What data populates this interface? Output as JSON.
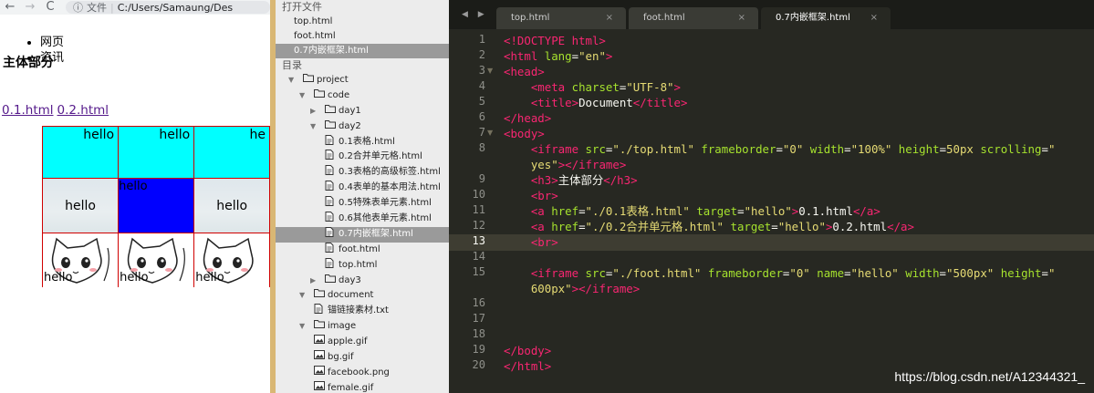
{
  "browser": {
    "back_icon": "←",
    "forward_icon": "→",
    "reload_icon": "C",
    "info_icon": "ⓘ",
    "url_label": "文件",
    "url_path": "C:/Users/Samaung/Des",
    "nav_items": [
      "网页",
      "资讯"
    ],
    "heading": "主体部分",
    "links": [
      "0.1.html",
      "0.2.html"
    ],
    "foot_table": {
      "row1": [
        "hello",
        "hello",
        "he"
      ],
      "row2": [
        "hello",
        "hello",
        "hello"
      ],
      "row3": [
        "hello",
        "hello",
        "hello"
      ]
    },
    "colors": {
      "cyan_cell": "#00ffff",
      "blue_cell": "#0000ff",
      "border": "#d00000",
      "link": "#551a8b"
    }
  },
  "sidebar": {
    "open_files_header": "打开文件",
    "open_files": [
      "top.html",
      "foot.html",
      "0.7内嵌框架.html"
    ],
    "folders_header": "目录",
    "tree": [
      {
        "label": "project",
        "type": "folder",
        "open": true,
        "depth": 0
      },
      {
        "label": "code",
        "type": "folder",
        "open": true,
        "depth": 1
      },
      {
        "label": "day1",
        "type": "folder",
        "open": false,
        "depth": 2
      },
      {
        "label": "day2",
        "type": "folder",
        "open": true,
        "depth": 2
      },
      {
        "label": "0.1表格.html",
        "type": "file",
        "depth": 3
      },
      {
        "label": "0.2合并单元格.html",
        "type": "file",
        "depth": 3
      },
      {
        "label": "0.3表格的高级标签.html",
        "type": "file",
        "depth": 3
      },
      {
        "label": "0.4表单的基本用法.html",
        "type": "file",
        "depth": 3
      },
      {
        "label": "0.5特殊表单元素.html",
        "type": "file",
        "depth": 3
      },
      {
        "label": "0.6其他表单元素.html",
        "type": "file",
        "depth": 3
      },
      {
        "label": "0.7内嵌框架.html",
        "type": "file",
        "depth": 3,
        "selected": true
      },
      {
        "label": "foot.html",
        "type": "file",
        "depth": 3
      },
      {
        "label": "top.html",
        "type": "file",
        "depth": 3
      },
      {
        "label": "day3",
        "type": "folder",
        "open": false,
        "depth": 2
      },
      {
        "label": "document",
        "type": "folder",
        "open": true,
        "depth": 1
      },
      {
        "label": "锚链接素材.txt",
        "type": "file",
        "depth": 2
      },
      {
        "label": "image",
        "type": "folder",
        "open": true,
        "depth": 1
      },
      {
        "label": "apple.gif",
        "type": "image",
        "depth": 2
      },
      {
        "label": "bg.gif",
        "type": "image",
        "depth": 2
      },
      {
        "label": "facebook.png",
        "type": "image",
        "depth": 2
      },
      {
        "label": "female.gif",
        "type": "image",
        "depth": 2
      }
    ]
  },
  "editor": {
    "tab_arrows": "◀ ▶",
    "tabs": [
      {
        "label": "top.html",
        "active": false
      },
      {
        "label": "foot.html",
        "active": false
      },
      {
        "label": "0.7内嵌框架.html",
        "active": true
      }
    ],
    "tab_close": "×",
    "current_line": 13,
    "lines": [
      {
        "n": "1",
        "segs": [
          [
            "tag",
            "<!DOCTYPE html>"
          ]
        ]
      },
      {
        "n": "2",
        "segs": [
          [
            "tag",
            "<html "
          ],
          [
            "attr",
            "lang"
          ],
          [
            "txt",
            "="
          ],
          [
            "str",
            "\"en\""
          ],
          [
            "tag",
            ">"
          ]
        ]
      },
      {
        "n": "3",
        "fold": true,
        "segs": [
          [
            "tag",
            "<head>"
          ]
        ]
      },
      {
        "n": "4",
        "segs": [
          [
            "txt",
            "    "
          ],
          [
            "tag",
            "<meta "
          ],
          [
            "attr",
            "charset"
          ],
          [
            "txt",
            "="
          ],
          [
            "str",
            "\"UTF-8\""
          ],
          [
            "tag",
            ">"
          ]
        ]
      },
      {
        "n": "5",
        "segs": [
          [
            "txt",
            "    "
          ],
          [
            "tag",
            "<title>"
          ],
          [
            "txt",
            "Document"
          ],
          [
            "tag",
            "</title>"
          ]
        ]
      },
      {
        "n": "6",
        "segs": [
          [
            "tag",
            "</head>"
          ]
        ]
      },
      {
        "n": "7",
        "fold": true,
        "segs": [
          [
            "tag",
            "<body>"
          ]
        ]
      },
      {
        "n": "8",
        "segs": [
          [
            "txt",
            "    "
          ],
          [
            "tag",
            "<iframe "
          ],
          [
            "attr",
            "src"
          ],
          [
            "txt",
            "="
          ],
          [
            "str",
            "\"./top.html\""
          ],
          [
            "txt",
            " "
          ],
          [
            "attr",
            "frameborder"
          ],
          [
            "txt",
            "="
          ],
          [
            "str",
            "\"0\""
          ],
          [
            "txt",
            " "
          ],
          [
            "attr",
            "width"
          ],
          [
            "txt",
            "="
          ],
          [
            "str",
            "\"100%\""
          ],
          [
            "txt",
            " "
          ],
          [
            "attr",
            "height"
          ],
          [
            "txt",
            "="
          ],
          [
            "str",
            "50px"
          ],
          [
            "txt",
            " "
          ],
          [
            "attr",
            "scrolling"
          ],
          [
            "txt",
            "="
          ],
          [
            "str",
            "\""
          ]
        ]
      },
      {
        "n": "",
        "segs": [
          [
            "txt",
            "    "
          ],
          [
            "str",
            "yes\""
          ],
          [
            "tag",
            "></iframe>"
          ]
        ]
      },
      {
        "n": "9",
        "segs": [
          [
            "txt",
            "    "
          ],
          [
            "tag",
            "<h3>"
          ],
          [
            "txt",
            "主体部分"
          ],
          [
            "tag",
            "</h3>"
          ]
        ]
      },
      {
        "n": "10",
        "segs": [
          [
            "txt",
            "    "
          ],
          [
            "tag",
            "<br>"
          ]
        ]
      },
      {
        "n": "11",
        "segs": [
          [
            "txt",
            "    "
          ],
          [
            "tag",
            "<a "
          ],
          [
            "attr",
            "href"
          ],
          [
            "txt",
            "="
          ],
          [
            "str",
            "\"./0.1表格.html\""
          ],
          [
            "txt",
            " "
          ],
          [
            "attr",
            "target"
          ],
          [
            "txt",
            "="
          ],
          [
            "str",
            "\"hello\""
          ],
          [
            "tag",
            ">"
          ],
          [
            "txt",
            "0.1.html"
          ],
          [
            "tag",
            "</a>"
          ]
        ]
      },
      {
        "n": "12",
        "segs": [
          [
            "txt",
            "    "
          ],
          [
            "tag",
            "<a "
          ],
          [
            "attr",
            "href"
          ],
          [
            "txt",
            "="
          ],
          [
            "str",
            "\"./0.2合并单元格.html\""
          ],
          [
            "txt",
            " "
          ],
          [
            "attr",
            "target"
          ],
          [
            "txt",
            "="
          ],
          [
            "str",
            "\"hello\""
          ],
          [
            "tag",
            ">"
          ],
          [
            "txt",
            "0.2.html"
          ],
          [
            "tag",
            "</a>"
          ]
        ]
      },
      {
        "n": "13",
        "segs": [
          [
            "txt",
            "    "
          ],
          [
            "tag",
            "<br>"
          ]
        ]
      },
      {
        "n": "14",
        "segs": []
      },
      {
        "n": "15",
        "segs": [
          [
            "txt",
            "    "
          ],
          [
            "tag",
            "<iframe "
          ],
          [
            "attr",
            "src"
          ],
          [
            "txt",
            "="
          ],
          [
            "str",
            "\"./foot.html\""
          ],
          [
            "txt",
            " "
          ],
          [
            "attr",
            "frameborder"
          ],
          [
            "txt",
            "="
          ],
          [
            "str",
            "\"0\""
          ],
          [
            "txt",
            " "
          ],
          [
            "attr",
            "name"
          ],
          [
            "txt",
            "="
          ],
          [
            "str",
            "\"hello\""
          ],
          [
            "txt",
            " "
          ],
          [
            "attr",
            "width"
          ],
          [
            "txt",
            "="
          ],
          [
            "str",
            "\"500px\""
          ],
          [
            "txt",
            " "
          ],
          [
            "attr",
            "height"
          ],
          [
            "txt",
            "="
          ],
          [
            "str",
            "\""
          ]
        ]
      },
      {
        "n": "",
        "segs": [
          [
            "txt",
            "    "
          ],
          [
            "str",
            "600px\""
          ],
          [
            "tag",
            "></iframe>"
          ]
        ]
      },
      {
        "n": "16",
        "segs": []
      },
      {
        "n": "17",
        "segs": []
      },
      {
        "n": "18",
        "segs": []
      },
      {
        "n": "19",
        "segs": [
          [
            "tag",
            "</body>"
          ]
        ]
      },
      {
        "n": "20",
        "segs": [
          [
            "tag",
            "</html>"
          ]
        ]
      }
    ],
    "watermark": "https://blog.csdn.net/A12344321_",
    "colors": {
      "background": "#272822",
      "tag": "#f92672",
      "attr": "#a6e22e",
      "string": "#e6db74",
      "text": "#f8f8f2"
    }
  }
}
